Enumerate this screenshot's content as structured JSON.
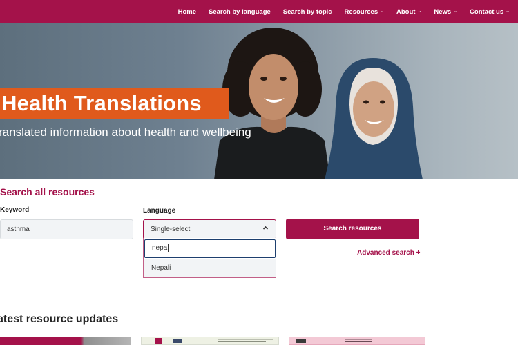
{
  "nav": {
    "items": [
      {
        "label": "Home",
        "dropdown": false
      },
      {
        "label": "Search by language",
        "dropdown": false
      },
      {
        "label": "Search by topic",
        "dropdown": false
      },
      {
        "label": "Resources",
        "dropdown": true
      },
      {
        "label": "About",
        "dropdown": true
      },
      {
        "label": "News",
        "dropdown": true
      },
      {
        "label": "Contact us",
        "dropdown": true
      }
    ]
  },
  "hero": {
    "title": "Health Translations",
    "subtitle": "ranslated information about health and wellbeing"
  },
  "search": {
    "section_title": "Search all resources",
    "keyword_label": "Keyword",
    "keyword_value": "asthma",
    "language_label": "Language",
    "language_select_value": "Single-select",
    "language_filter_value": "nepa",
    "language_option": "Nepali",
    "submit_label": "Search resources",
    "advanced_link": "Advanced search +"
  },
  "latest": {
    "title": "atest resource updates"
  },
  "colors": {
    "brand": "#a4124a",
    "hero_accent": "#e05a1c",
    "focus": "#1d3f6e"
  },
  "icons": {
    "nav_dropdown": "chevron-down-icon",
    "select_open": "chevron-up-icon"
  }
}
